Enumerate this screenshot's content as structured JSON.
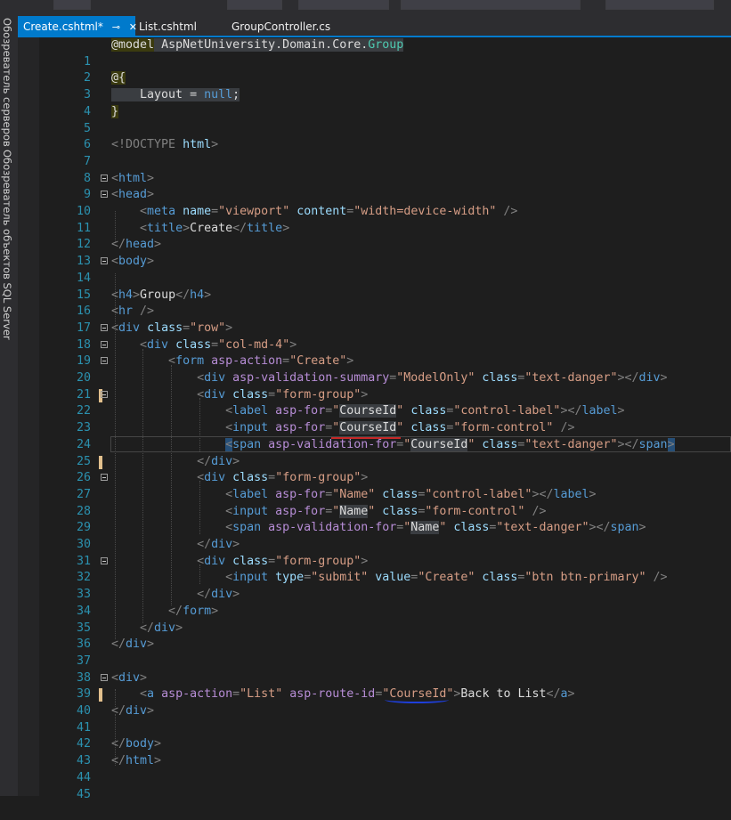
{
  "side_panel": {
    "item1": "Обозреватель серверов",
    "item2": "Обозреватель объектов SQL Server"
  },
  "tabs": [
    {
      "label": "Create.cshtml*",
      "active": true,
      "pin_icon": "pin-icon",
      "close_icon": "close-icon"
    },
    {
      "label": "List.cshtml",
      "active": false
    },
    {
      "label": "GroupController.cs",
      "active": false
    }
  ],
  "line_numbers": [
    "1",
    "2",
    "3",
    "4",
    "5",
    "6",
    "7",
    "8",
    "9",
    "10",
    "11",
    "12",
    "13",
    "14",
    "15",
    "16",
    "17",
    "18",
    "19",
    "20",
    "21",
    "22",
    "23",
    "24",
    "25",
    "26",
    "27",
    "28",
    "29",
    "30",
    "31",
    "32",
    "33",
    "34",
    "35",
    "36",
    "37",
    "38",
    "39",
    "40",
    "41",
    "42",
    "43",
    "44",
    "45"
  ],
  "code": {
    "l1_dir": "@model",
    "l1_type": "AspNetUniversity.Domain.Core.",
    "l1_cls": "Group",
    "l3": "@{",
    "l4_a": "Layout",
    "l4_b": " = ",
    "l4_c": "null",
    "l4_d": ";",
    "l5": "}",
    "l7_a": "<!DOCTYPE ",
    "l7_b": "html",
    "l7_c": ">",
    "html_tag": "html",
    "head_tag": "head",
    "meta_tag": "meta",
    "name_attr": "name",
    "viewport_val": "\"viewport\"",
    "content_attr": "content",
    "content_val": "\"width=device-width\"",
    "title_tag": "title",
    "title_text": "Create",
    "body_tag": "body",
    "h4_tag": "h4",
    "h4_text": "Group",
    "hr_tag": "hr",
    "div_tag": "div",
    "class_attr": "class",
    "row_val": "\"row\"",
    "colmd_val": "\"col-md-4\"",
    "form_tag": "form",
    "asp_action": "asp-action",
    "create_val": "\"Create\"",
    "asp_valsum": "asp-validation-summary",
    "modelonly_val": "\"ModelOnly\"",
    "textdanger_val": "\"text-danger\"",
    "formgroup_val": "\"form-group\"",
    "label_tag": "label",
    "asp_for": "asp-for",
    "courseid_val": "CourseId",
    "controllabel_val": "\"control-label\"",
    "input_tag": "input",
    "formcontrol_val": "\"form-control\"",
    "span_tag": "span",
    "asp_valfor": "asp-validation-for",
    "name_val": "Name",
    "type_attr": "type",
    "submit_val": "\"submit\"",
    "value_attr": "value",
    "btn_val": "\"btn btn-primary\"",
    "a_tag": "a",
    "list_val": "List",
    "asp_routeid": "asp-route-id",
    "back_text": "Back to List"
  },
  "colors": {
    "accent": "#007acc",
    "background": "#1e1e1e",
    "tag": "#569cd6",
    "attribute": "#9cdcfe",
    "string": "#d69d85"
  }
}
